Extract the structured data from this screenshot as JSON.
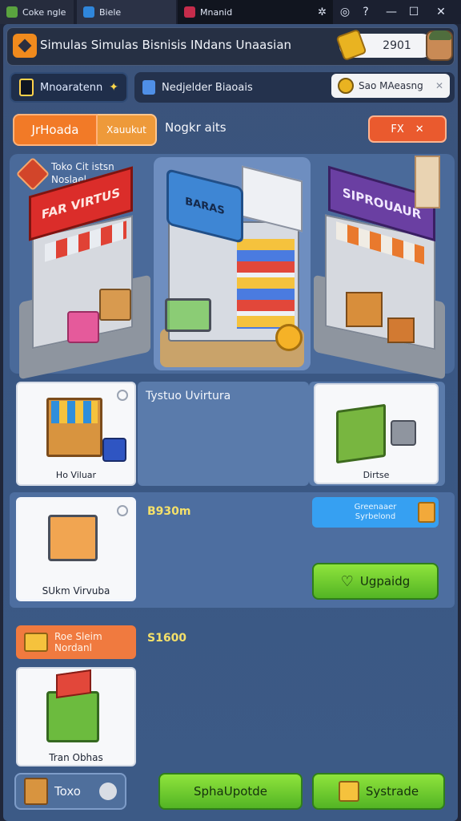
{
  "browser": {
    "tabs": [
      {
        "label": "Coke ngle"
      },
      {
        "label": "Biele"
      },
      {
        "label": "Mnanid"
      }
    ]
  },
  "header": {
    "title": "Simulas Simulas Bisnisis INdans Unaasian",
    "coins": "2901"
  },
  "row2": {
    "left_label": "Mnoaratenn",
    "mid_label": "Nedjelder Biaoais",
    "search_value": "Sao MAeasng"
  },
  "tabs": {
    "active": "JrHoada",
    "second": "Xauukut",
    "label": "Nogkr aits",
    "right_label": "FX"
  },
  "stores": {
    "title_line1": "Toko Cit istsn",
    "title_line2": "Noslael",
    "left_sign": "FAR VIRTUS",
    "center_sign": "BARAS",
    "right_sign": "SIPROUAUR"
  },
  "items": {
    "item1_label": "Ho Viluar",
    "row1_text": "Tystuo Uvirtura",
    "item2_label": "Dirtse",
    "item3_label": "SUkm Virvuba",
    "price1": "B930m",
    "blue_line1": "Greenaaer",
    "blue_line2": "Syrbelond",
    "upgrade_label": "Ugpaidg",
    "orange_line1": "Roe Sleim",
    "orange_line2": "Nordanl",
    "price2": "S1600",
    "item4_label": "Tran Obhas"
  },
  "bottom": {
    "left_label": "Toxo",
    "btn1": "SphaUpotde",
    "btn2": "Systrade"
  },
  "colors": {
    "accent_orange": "#f27a27",
    "green": "#6bcb2d",
    "blue": "#36a0f2"
  }
}
